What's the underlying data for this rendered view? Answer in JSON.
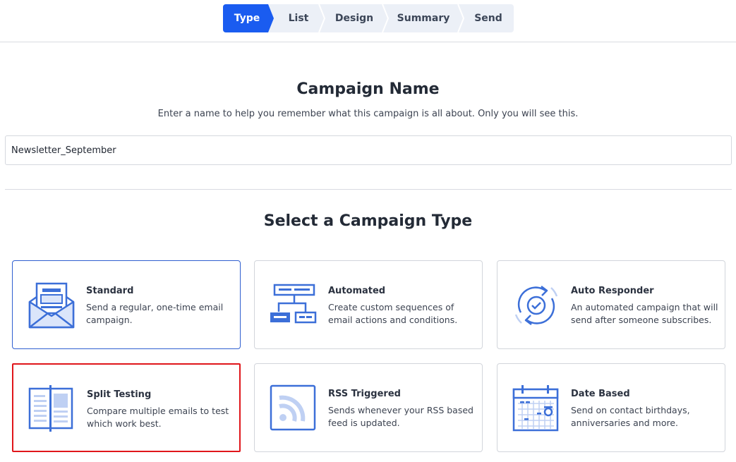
{
  "stepper": {
    "steps": [
      {
        "label": "Type",
        "active": true
      },
      {
        "label": "List",
        "active": false
      },
      {
        "label": "Design",
        "active": false
      },
      {
        "label": "Summary",
        "active": false
      },
      {
        "label": "Send",
        "active": false
      }
    ]
  },
  "campaign_name": {
    "title": "Campaign Name",
    "subtitle": "Enter a name to help you remember what this campaign is all about. Only you will see this.",
    "value": "Newsletter_September"
  },
  "campaign_type": {
    "title": "Select a Campaign Type",
    "cards": [
      {
        "title": "Standard",
        "description": "Send a regular, one-time email campaign.",
        "icon": "envelope-icon",
        "selected": true
      },
      {
        "title": "Automated",
        "description": "Create custom sequences of email actions and conditions.",
        "icon": "flowchart-icon"
      },
      {
        "title": "Auto Responder",
        "description": "An automated campaign that will send after someone subscribes.",
        "icon": "refresh-check-icon"
      },
      {
        "title": "Split Testing",
        "description": "Compare multiple emails to test which work best.",
        "icon": "split-layout-icon",
        "highlighted": true
      },
      {
        "title": "RSS Triggered",
        "description": "Sends whenever your RSS based feed is updated.",
        "icon": "rss-icon"
      },
      {
        "title": "Date Based",
        "description": "Send on contact birthdays, anniversaries and more.",
        "icon": "calendar-icon"
      }
    ]
  },
  "colors": {
    "accent": "#1a5cf0",
    "icon_blue": "#3c6fd8",
    "highlight_red": "#e0161b"
  }
}
